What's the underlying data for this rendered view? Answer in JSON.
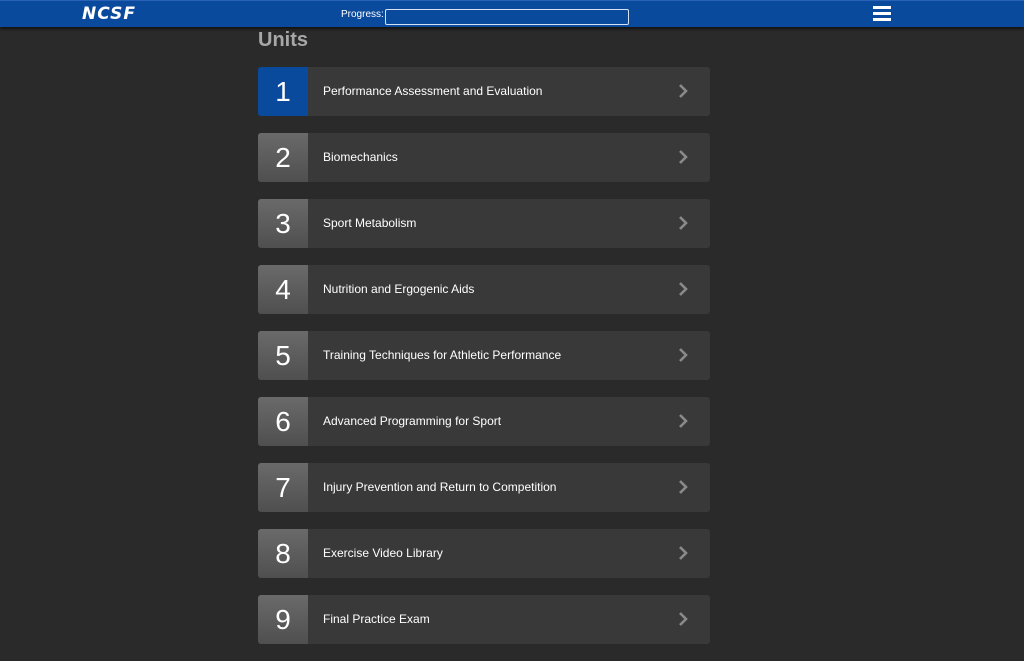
{
  "header": {
    "logo_text": "NCSF",
    "progress_label": "Progress:",
    "progress_value": 0,
    "menu_icon": "hamburger-menu-icon"
  },
  "main": {
    "heading": "Units",
    "units": [
      {
        "number": "1",
        "title": "Performance Assessment and Evaluation",
        "active": true
      },
      {
        "number": "2",
        "title": "Biomechanics",
        "active": false
      },
      {
        "number": "3",
        "title": "Sport Metabolism",
        "active": false
      },
      {
        "number": "4",
        "title": "Nutrition and Ergogenic Aids",
        "active": false
      },
      {
        "number": "5",
        "title": "Training Techniques for Athletic Performance",
        "active": false
      },
      {
        "number": "6",
        "title": "Advanced Programming for Sport",
        "active": false
      },
      {
        "number": "7",
        "title": "Injury Prevention and Return to Competition",
        "active": false
      },
      {
        "number": "8",
        "title": "Exercise Video Library",
        "active": false
      },
      {
        "number": "9",
        "title": "Final Practice Exam",
        "active": false
      }
    ],
    "row_icon": "chevron-right-icon"
  },
  "colors": {
    "header_bg": "#0a4a9c",
    "page_bg": "#2b2a2a",
    "row_bg": "#3a3939",
    "active_number_bg": "#0a4a9c",
    "heading_text": "#a7a7a7"
  }
}
